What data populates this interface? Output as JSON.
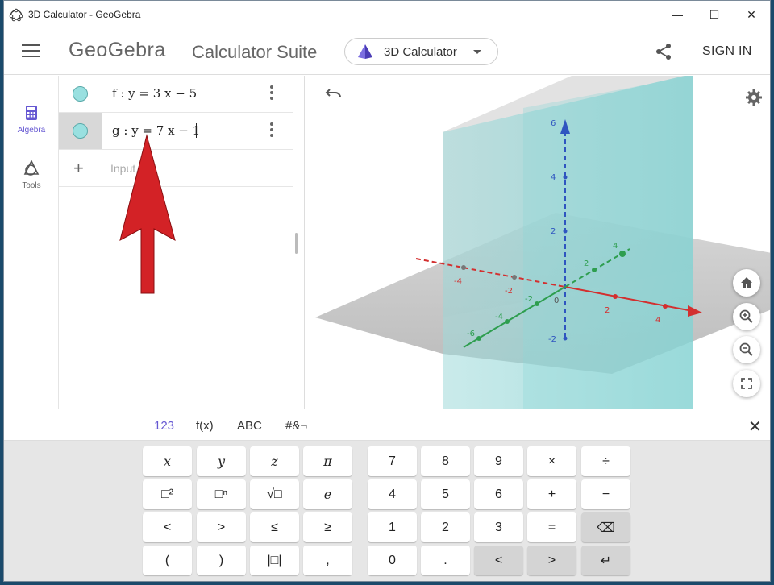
{
  "window": {
    "title": "3D Calculator - GeoGebra",
    "controls": {
      "minimize": "—",
      "maximize": "☐",
      "close": "✕"
    }
  },
  "header": {
    "logo": "GeoGebra",
    "suite": "Calculator Suite",
    "app_select": "3D Calculator",
    "signin": "SIGN IN"
  },
  "rail": {
    "items": [
      {
        "label": "Algebra",
        "icon": "calculator-icon",
        "active": true
      },
      {
        "label": "Tools",
        "icon": "tools-shapes-icon",
        "active": false
      }
    ]
  },
  "algebra": {
    "rows": [
      {
        "expr": "f : y = 3 x − 5",
        "active": false
      },
      {
        "expr": "g : y = 7 x − 1",
        "active": true
      }
    ],
    "input_placeholder": "Input..."
  },
  "graphics": {
    "z_ticks": [
      "6",
      "4",
      "2",
      "-2"
    ],
    "x_ticks": [
      "-4",
      "-2",
      "2",
      "4"
    ],
    "y_ticks": [
      "4",
      "2",
      "-2",
      "-4",
      "-6"
    ],
    "origin": "0",
    "colors": {
      "x_axis": "#d32f2f",
      "y_axis": "#2e9e4f",
      "z_axis": "#2f55c0",
      "plane": "#7fd0d0"
    }
  },
  "keyboard": {
    "tabs": [
      "123",
      "f(x)",
      "ABC",
      "#&¬"
    ],
    "active_tab": "123",
    "close": "✕",
    "left_keys": [
      "x",
      "y",
      "z",
      "π",
      "□²",
      "□ⁿ",
      "√□",
      "e",
      "<",
      ">",
      "≤",
      "≥",
      "(",
      ")",
      "|□|",
      ","
    ],
    "right_keys": [
      "7",
      "8",
      "9",
      "×",
      "÷",
      "4",
      "5",
      "6",
      "+",
      "−",
      "1",
      "2",
      "3",
      "=",
      "⌫",
      "0",
      ".",
      "<",
      ">",
      "↵"
    ]
  }
}
